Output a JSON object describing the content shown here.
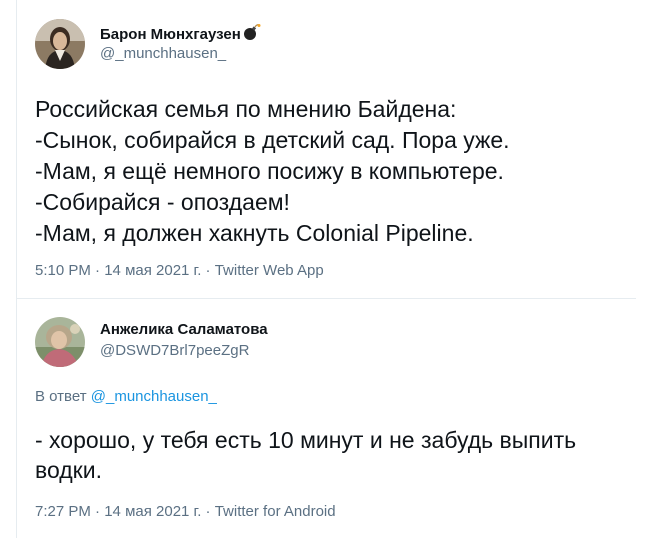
{
  "tweets": [
    {
      "author_name": "Барон Мюнхгаузен",
      "handle": "@_munchhausen_",
      "lines": [
        "Российская семья по мнению Байдена:",
        "-Сынок, собирайся в детский сад. Пора уже.",
        "-Мам, я ещё немного посижу в компьютере.",
        "-Собирайся - опоздаем!",
        "-Мам, я должен хакнуть Colonial Pipeline."
      ],
      "time": "5:10 PM",
      "date": "14 мая 2021 г.",
      "source": "Twitter Web App"
    },
    {
      "author_name": "Анжелика Саламатова",
      "handle": "@DSWD7Brl7peeZgR",
      "reply_prefix": "В ответ",
      "reply_mention": "@_munchhausen_",
      "text": "- хорошо, у тебя есть 10 минут и не забудь выпить водки.",
      "time": "7:27 PM",
      "date": "14 мая 2021 г.",
      "source": "Twitter for Android"
    }
  ],
  "colors": {
    "text": "#0f1419",
    "secondary": "#5b7083",
    "link": "#1b95e0",
    "divider": "#e6ecf0"
  },
  "icons": [
    "bomb-icon"
  ]
}
